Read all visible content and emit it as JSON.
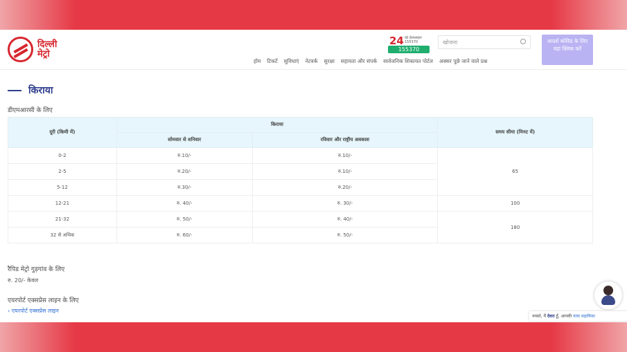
{
  "brand": {
    "logo_text_line1": "दिल्ली",
    "logo_text_line2": "मेट्रो"
  },
  "counter": {
    "number": "24",
    "caption": "घंटे हेल्पलाइन 155370",
    "badge": "155370"
  },
  "search": {
    "placeholder": "खोजना"
  },
  "accessibility_button": "आदर्श कोविड के लिए यहां क्लिक करें",
  "nav": [
    "होम",
    "टिकटें",
    "सुविधाएं",
    "नेटवर्क",
    "सुरक्षा",
    "सहायता और संपर्क",
    "सार्वजनिक शिकायत पोर्टल",
    "अक्सर पूछे जाने वाले प्रश्न"
  ],
  "page_title": "किराया",
  "section_metro": "डीएमआरसी के लिए",
  "table": {
    "col_distance": "दूरी (किमी में)",
    "col_fare": "किराया",
    "col_weekday": "सोमवार से शनिवार",
    "col_sunday": "रविवार और राष्ट्रीय अवकाश",
    "col_time": "समय सीमा (मिनट में)",
    "rows": [
      {
        "distance": "0-2",
        "weekday": "रु.10/-",
        "sunday": "रु.10/-"
      },
      {
        "distance": "2-5",
        "weekday": "रु.20/-",
        "sunday": "रु.10/-"
      },
      {
        "distance": "5-12",
        "weekday": "रु.30/-",
        "sunday": "रु.20/-"
      },
      {
        "distance": "12-21",
        "weekday": "रु. 40/-",
        "sunday": "रु. 30/-"
      },
      {
        "distance": "21-32",
        "weekday": "रु. 50/-",
        "sunday": "रु. 40/-"
      },
      {
        "distance": "32 से अधिक",
        "weekday": "रु. 60/-",
        "sunday": "रु. 50/-"
      }
    ],
    "time_limits": [
      "65",
      "100",
      "180"
    ]
  },
  "section_rapid": "रैपिड मेट्रो गुड़गांव के लिए",
  "rapid_fare": "रु. 20/- केवल",
  "section_airport": "एयरपोर्ट एक्सप्रेस लाइन के लिए",
  "airport_link": "एयरपोर्ट एक्सप्रेस लाइन",
  "chatbot": {
    "prefix": "नमस्ते, मैं",
    "name": "देवरा",
    "middle": "हूँ, आपकी",
    "link": "यात्रा सहायिका"
  }
}
